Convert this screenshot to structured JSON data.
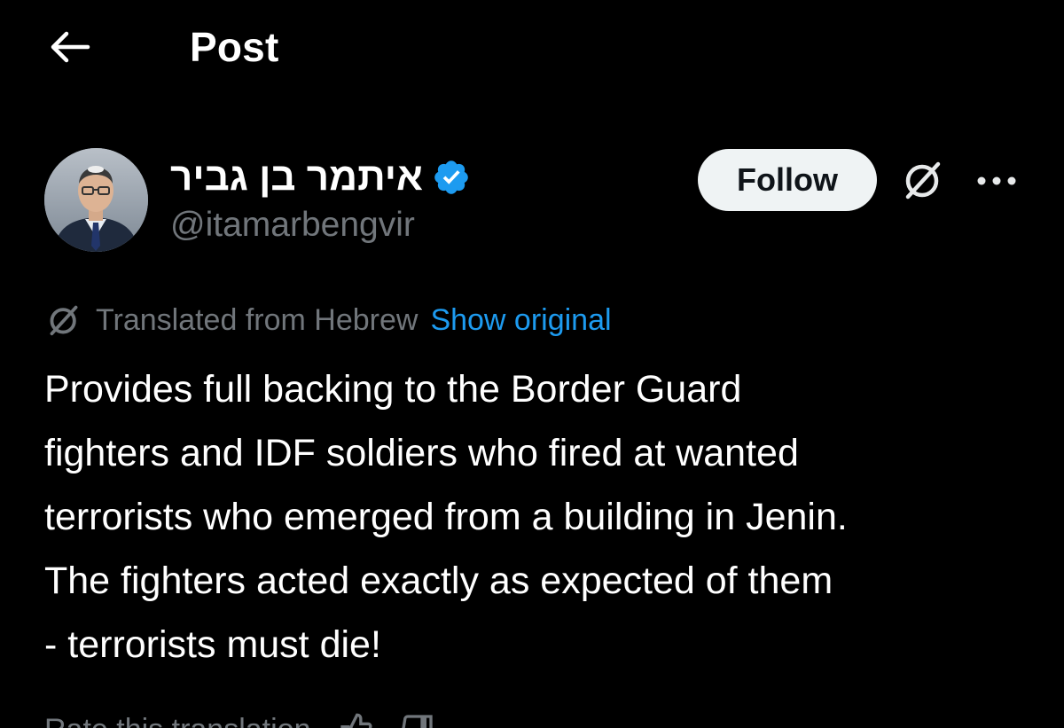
{
  "header": {
    "title": "Post"
  },
  "author": {
    "display_name": "איתמר בן גביר",
    "handle": "@itamarbengvir",
    "verified": true
  },
  "actions": {
    "follow_label": "Follow"
  },
  "translation": {
    "label": "Translated from Hebrew",
    "show_original": "Show original"
  },
  "post": {
    "text": "Provides full backing to the Border Guard\nfighters and IDF soldiers who fired at wanted\nterrorists who emerged from a building in Jenin.\nThe fighters acted exactly as expected of them\n- terrorists must die!"
  },
  "rating": {
    "label": "Rate this translation"
  },
  "colors": {
    "background": "#000000",
    "text": "#ffffff",
    "secondary": "#71767b",
    "link": "#1d9bf0",
    "follow_bg": "#eff3f4",
    "verified": "#1d9bf0"
  }
}
